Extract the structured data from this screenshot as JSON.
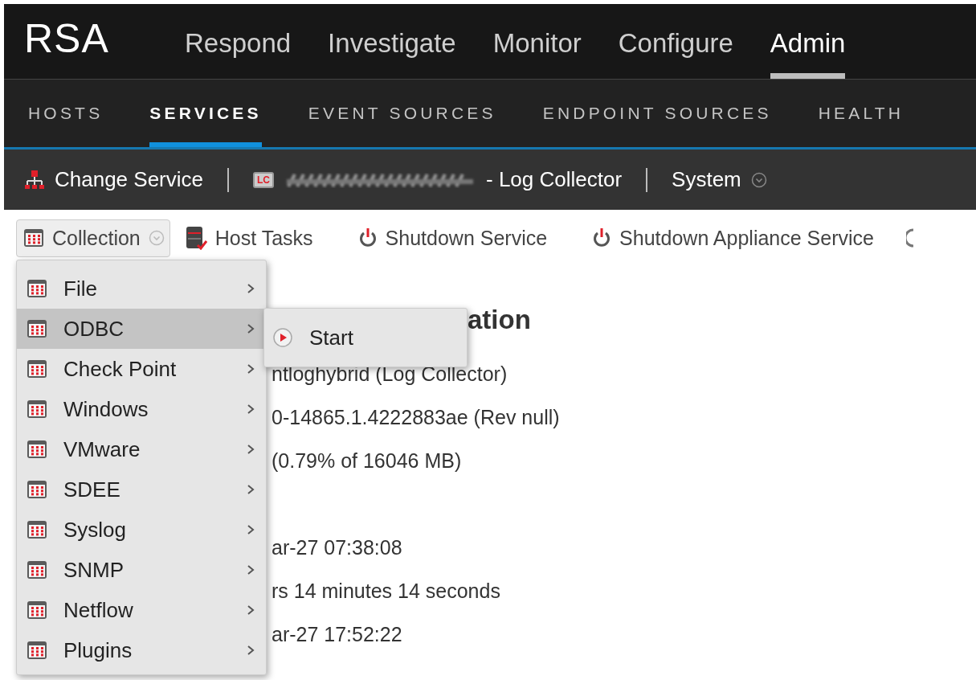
{
  "logo": "RSA",
  "nav": [
    {
      "label": "Respond",
      "selected": false
    },
    {
      "label": "Investigate",
      "selected": false
    },
    {
      "label": "Monitor",
      "selected": false
    },
    {
      "label": "Configure",
      "selected": false
    },
    {
      "label": "Admin",
      "selected": true
    }
  ],
  "subnav": [
    {
      "label": "HOSTS",
      "selected": false
    },
    {
      "label": "SERVICES",
      "selected": true
    },
    {
      "label": "EVENT SOURCES",
      "selected": false
    },
    {
      "label": "ENDPOINT SOURCES",
      "selected": false
    },
    {
      "label": "HEALTH",
      "selected": false
    }
  ],
  "service_bar": {
    "change_service": "Change Service",
    "badge": "LC",
    "service_name": "- Log Collector",
    "system": "System"
  },
  "toolbar": [
    {
      "kind": "dropdown",
      "label": "Collection"
    },
    {
      "kind": "tasks",
      "label": "Host Tasks"
    },
    {
      "kind": "power",
      "label": "Shutdown Service"
    },
    {
      "kind": "power",
      "label": "Shutdown Appliance Service"
    },
    {
      "kind": "cutoff"
    }
  ],
  "menu": [
    {
      "label": "File",
      "selected": false
    },
    {
      "label": "ODBC",
      "selected": true
    },
    {
      "label": "Check Point",
      "selected": false
    },
    {
      "label": "Windows",
      "selected": false
    },
    {
      "label": "VMware",
      "selected": false
    },
    {
      "label": "SDEE",
      "selected": false
    },
    {
      "label": "Syslog",
      "selected": false
    },
    {
      "label": "SNMP",
      "selected": false
    },
    {
      "label": "Netflow",
      "selected": false
    },
    {
      "label": "Plugins",
      "selected": false
    }
  ],
  "submenu": [
    {
      "label": "Start"
    }
  ],
  "content": {
    "heading": "ation",
    "groups": [
      [
        "ntloghybrid (Log Collector)",
        "0-14865.1.4222883ae (Rev null)",
        "(0.79% of 16046 MB)"
      ],
      [
        "ar-27 07:38:08",
        "rs 14 minutes 14 seconds",
        "ar-27 17:52:22"
      ]
    ]
  }
}
